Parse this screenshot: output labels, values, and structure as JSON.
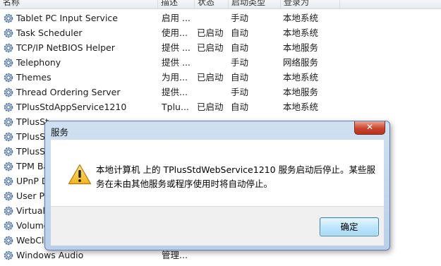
{
  "columns": {
    "name": "名称",
    "description": "描述",
    "status": "状态",
    "startup_type": "启动类型",
    "log_on_as": "登录为"
  },
  "services": [
    {
      "name": "Tablet PC Input Service",
      "description": "启用 ...",
      "status": "",
      "startup": "手动",
      "login": "本地系统"
    },
    {
      "name": "Task Scheduler",
      "description": "使用...",
      "status": "已启动",
      "startup": "自动",
      "login": "本地系统"
    },
    {
      "name": "TCP/IP NetBIOS Helper",
      "description": "提供 ...",
      "status": "已启动",
      "startup": "自动",
      "login": "本地服务"
    },
    {
      "name": "Telephony",
      "description": "提供 ...",
      "status": "",
      "startup": "手动",
      "login": "网络服务"
    },
    {
      "name": "Themes",
      "description": "为用...",
      "status": "已启动",
      "startup": "自动",
      "login": "本地系统"
    },
    {
      "name": "Thread Ordering Server",
      "description": "提供...",
      "status": "",
      "startup": "手动",
      "login": "本地服务"
    },
    {
      "name": "TPlusStdAppService1210",
      "description": "Tplu...",
      "status": "已启动",
      "startup": "自动",
      "login": "本地系统"
    },
    {
      "name": "TPlusSt",
      "description": "",
      "status": "",
      "startup": "",
      "login": ""
    },
    {
      "name": "TPlusSt",
      "description": "",
      "status": "",
      "startup": "",
      "login": ""
    },
    {
      "name": "TPlusSt",
      "description": "",
      "status": "",
      "startup": "",
      "login": ""
    },
    {
      "name": "TPM Ba",
      "description": "",
      "status": "",
      "startup": "",
      "login": ""
    },
    {
      "name": "UPnP D",
      "description": "",
      "status": "",
      "startup": "",
      "login": ""
    },
    {
      "name": "User Pr",
      "description": "",
      "status": "",
      "startup": "",
      "login": ""
    },
    {
      "name": "Virtual",
      "description": "",
      "status": "",
      "startup": "",
      "login": ""
    },
    {
      "name": "Volume",
      "description": "",
      "status": "",
      "startup": "",
      "login": ""
    },
    {
      "name": "WebCli",
      "description": "",
      "status": "",
      "startup": "",
      "login": ""
    },
    {
      "name": "Windows Audio",
      "description": "管理...",
      "status": "",
      "startup": "",
      "login": ""
    }
  ],
  "dialog": {
    "title": "服务",
    "close_label": "✕",
    "icon": "warning-icon",
    "message_line1": "本地计算机 上的 TPlusStdWebService1210 服务启动后停止。某些服",
    "message_line2": "务在未由其他服务或程序使用时将自动停止。",
    "ok_label": "确定"
  }
}
